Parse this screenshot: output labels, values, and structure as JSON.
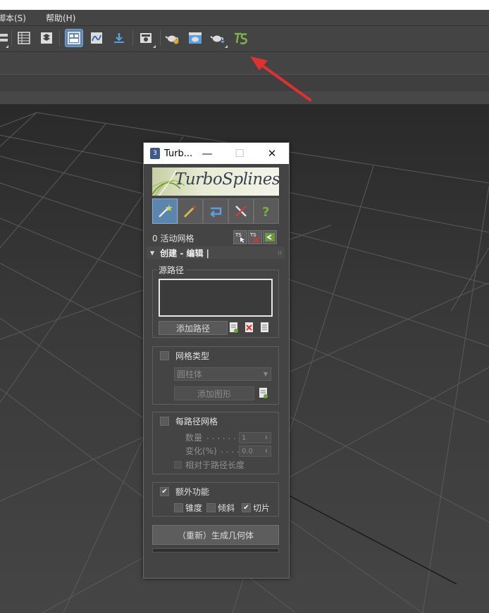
{
  "menu": {
    "items": [
      {
        "label": "脚本(S)"
      },
      {
        "label": "帮助(H)"
      }
    ]
  },
  "toolbar": {
    "icons": [
      "unknown-icon",
      "table-icon",
      "layers-icon",
      "active-panel-icon",
      "curve-editor-icon",
      "download-icon",
      "render-setup-icon",
      "teapot-settings-icon",
      "render-frame-icon",
      "teapot-render-icon",
      "turbosplines-icon"
    ]
  },
  "dialog": {
    "title": "Turb...",
    "app_icon": "3",
    "minimize": "—",
    "maximize": "☐",
    "close": "✕",
    "logo_text": "TurboSplines",
    "status": "0 活动网格",
    "rollout_title": "创建 - 编辑 |",
    "source_path": {
      "title": "源路径",
      "add_button": "添加路径"
    },
    "mesh_type": {
      "checkbox_label": "网格类型",
      "dropdown_value": "圆柱体",
      "add_shape_button": "添加图形"
    },
    "per_path_mesh": {
      "checkbox_label": "每路径网格",
      "count_label": "数量",
      "count_value": "1",
      "variation_label": "变化(%)",
      "variation_value": "0.0",
      "relative_label": "相对于路径长度"
    },
    "extras": {
      "checkbox_label": "额外功能",
      "checked": true,
      "taper_label": "锥度",
      "bevel_label": "倾斜",
      "slice_label": "切片",
      "slice_checked": true
    },
    "generate_button": "（重新）生成几何体"
  },
  "colors": {
    "accent": "#5c85ad",
    "arrow": "#e03030",
    "panel": "#444444"
  }
}
